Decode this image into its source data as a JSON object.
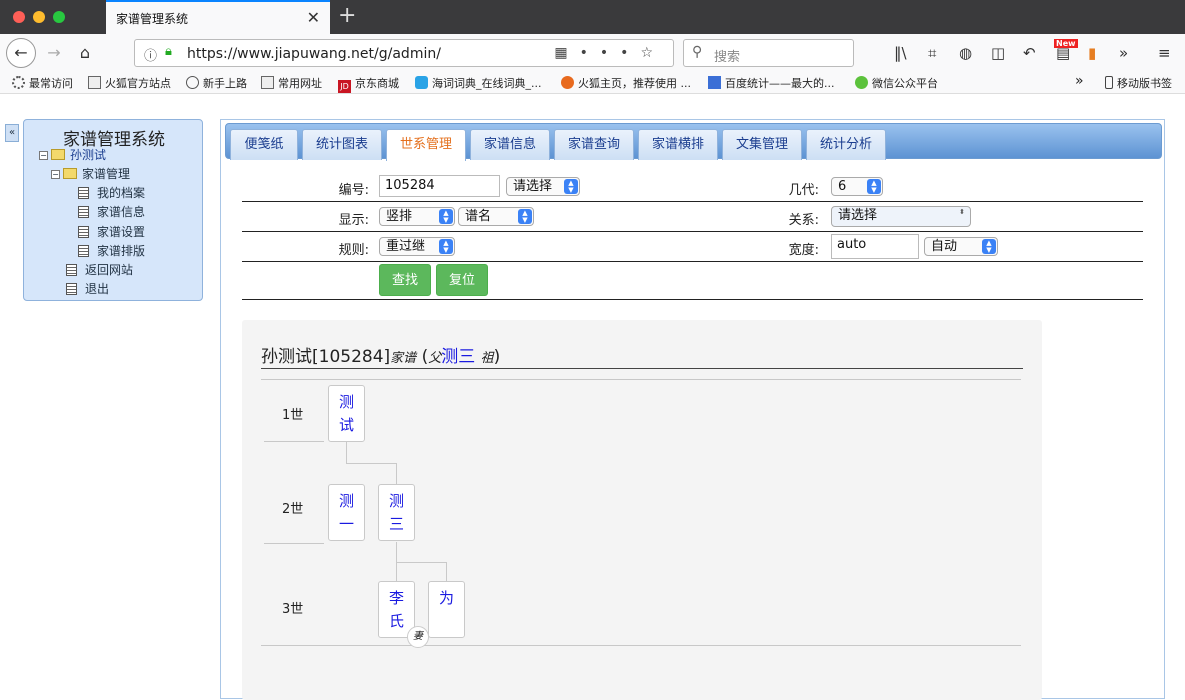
{
  "browser": {
    "tab_title": "家谱管理系统",
    "url": "https://www.jiapuwang.net/g/admin/",
    "search_placeholder": "搜索",
    "new_badge": "New",
    "bookmarks": [
      "最常访问",
      "火狐官方站点",
      "新手上路",
      "常用网址",
      "京东商城",
      "海词词典_在线词典_...",
      "火狐主页，推荐使用 ...",
      "百度统计——最大的...",
      "微信公众平台"
    ],
    "mobile_bookmarks": "移动版书签"
  },
  "sidebar": {
    "title": "家谱管理系统",
    "collapse_label": "«",
    "root": "孙测试",
    "group": "家谱管理",
    "items": [
      "我的档案",
      "家谱信息",
      "家谱设置",
      "家谱排版"
    ],
    "back": "返回网站",
    "logout": "退出"
  },
  "tabs": [
    "便笺纸",
    "统计图表",
    "世系管理",
    "家谱信息",
    "家谱查询",
    "家谱横排",
    "文集管理",
    "统计分析"
  ],
  "active_tab": "世系管理",
  "form": {
    "id_label": "编号:",
    "id_value": "105284",
    "id_select": "请选择",
    "gen_label": "几代:",
    "gen_value": "6",
    "display_label": "显示:",
    "display_value1": "竖排",
    "display_value2": "谱名",
    "relation_label": "关系:",
    "relation_value": "请选择",
    "rule_label": "规则:",
    "rule_value": "重过继",
    "width_label": "宽度:",
    "width_value": "auto",
    "width_select": "自动",
    "search_btn": "查找",
    "reset_btn": "复位"
  },
  "tree": {
    "title_main": "孙测试[105284]",
    "title_suffix": "家谱",
    "paren_open": "(",
    "father_label": "父",
    "father_name": "测三",
    "grand_label": "祖",
    "paren_close": ")",
    "generations": [
      "1世",
      "2世",
      "3世"
    ],
    "nodes": {
      "g1": [
        "测",
        "试"
      ],
      "g2a": [
        "测",
        "一"
      ],
      "g2b": [
        "测",
        "三"
      ],
      "g3a": [
        "李",
        "氏"
      ],
      "g3b": [
        "为"
      ]
    },
    "wife_badge": "妻"
  }
}
